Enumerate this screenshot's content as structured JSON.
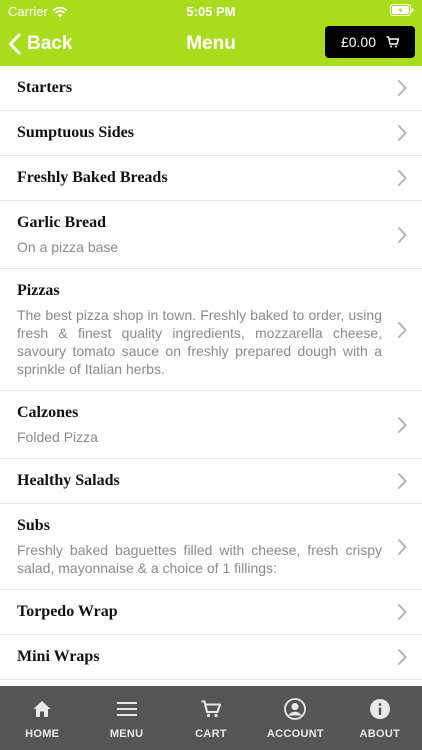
{
  "status_bar": {
    "carrier": "Carrier",
    "time": "5:05 PM"
  },
  "nav": {
    "back_label": "Back",
    "title": "Menu",
    "cart_total": "£0.00"
  },
  "menu_items": [
    {
      "title": "Starters",
      "description": ""
    },
    {
      "title": "Sumptuous Sides",
      "description": ""
    },
    {
      "title": "Freshly Baked Breads",
      "description": ""
    },
    {
      "title": "Garlic Bread",
      "description": "On a pizza base"
    },
    {
      "title": "Pizzas",
      "description": "The best pizza shop in town. Freshly baked to order, using fresh & finest quality ingredients, mozzarella cheese, savoury tomato sauce on freshly prepared dough with a sprinkle of Italian herbs."
    },
    {
      "title": "Calzones",
      "description": "Folded Pizza"
    },
    {
      "title": "Healthy Salads",
      "description": ""
    },
    {
      "title": "Subs",
      "description": "Freshly baked baguettes filled with cheese, fresh crispy salad, mayonnaise & a choice of 1 fillings:"
    },
    {
      "title": "Torpedo Wrap",
      "description": ""
    },
    {
      "title": "Mini Wraps",
      "description": ""
    }
  ],
  "tab_bar": {
    "home": "HOME",
    "menu": "MENU",
    "cart": "CART",
    "account": "ACCOUNT",
    "about": "ABOUT"
  },
  "colors": {
    "accent": "#a8dc1c",
    "tab_bar": "#555555",
    "cart_button": "#000000"
  }
}
